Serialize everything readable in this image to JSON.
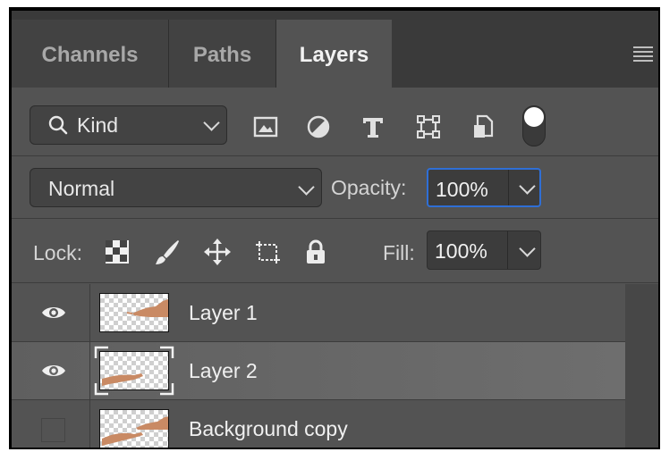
{
  "tabs": [
    {
      "label": "Channels",
      "active": false
    },
    {
      "label": "Paths",
      "active": false
    },
    {
      "label": "Layers",
      "active": true
    }
  ],
  "filter": {
    "kind_label": "Kind",
    "icons": [
      "image-filter-icon",
      "adjustment-filter-icon",
      "type-filter-icon",
      "shape-filter-icon",
      "smart-object-filter-icon"
    ]
  },
  "blend": {
    "mode": "Normal",
    "opacity_label": "Opacity:",
    "opacity_value": "100%"
  },
  "lock": {
    "label": "Lock:",
    "fill_label": "Fill:",
    "fill_value": "100%"
  },
  "layers": [
    {
      "name": "Layer 1",
      "visible": true,
      "selected": false
    },
    {
      "name": "Layer 2",
      "visible": true,
      "selected": true
    },
    {
      "name": "Background copy",
      "visible": false,
      "selected": false
    }
  ],
  "colors": {
    "panel": "#535353",
    "selected_row": "#6a6a6a",
    "focus_border": "#2f6fd6"
  }
}
